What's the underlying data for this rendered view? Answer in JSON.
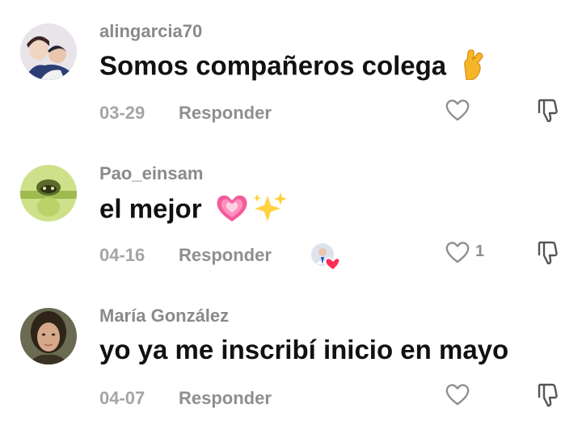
{
  "comments": [
    {
      "username": "alingarcia70",
      "text": "Somos compañeros colega",
      "emoji": "fingers-crossed-icon",
      "date": "03-29",
      "reply_label": "Responder",
      "like_count": ""
    },
    {
      "username": "Pao_einsam",
      "text": "el mejor",
      "emoji": "heart-sparkles-icon",
      "date": "04-16",
      "reply_label": "Responder",
      "like_count": "1",
      "creator_liked": true
    },
    {
      "username": "María González",
      "text": "yo ya me inscribí inicio en mayo",
      "date": "04-07",
      "reply_label": "Responder",
      "like_count": ""
    }
  ],
  "colors": {
    "username": "#8a8a8a",
    "text": "#111111",
    "meta": "#a5a5a5",
    "heart_badge": "#fe2c55"
  }
}
